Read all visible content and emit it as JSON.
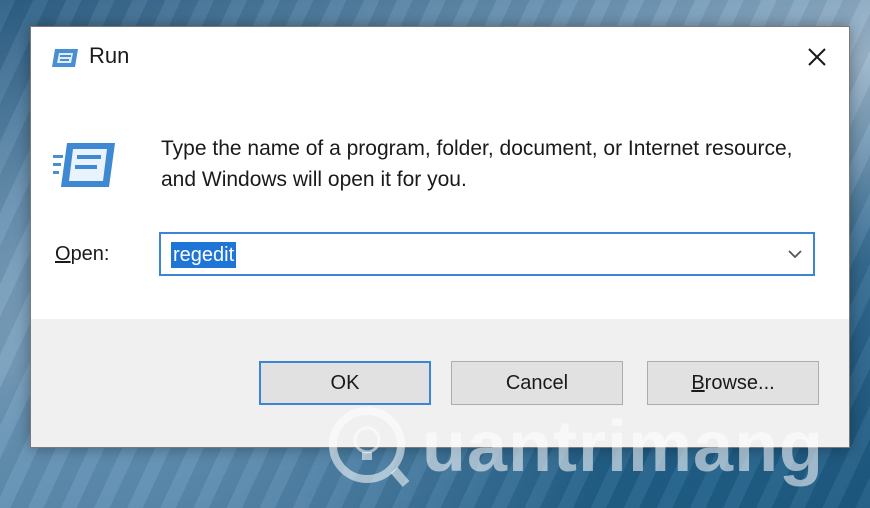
{
  "window": {
    "title": "Run",
    "close_icon": "close-icon",
    "app_icon": "run-icon"
  },
  "body": {
    "message": "Type the name of a program, folder, document, or Internet resource, and Windows will open it for you.",
    "open_label_underlined": "O",
    "open_label_rest": "pen:",
    "open_value": "regedit",
    "dropdown_icon": "chevron-down-icon"
  },
  "buttons": {
    "ok": "OK",
    "cancel": "Cancel",
    "browse_underlined": "B",
    "browse_rest": "rowse..."
  },
  "watermark": {
    "text": "uantrimang"
  },
  "colors": {
    "accent": "#3c84d4",
    "selection": "#1f74d8",
    "footer": "#f0f0f0"
  }
}
